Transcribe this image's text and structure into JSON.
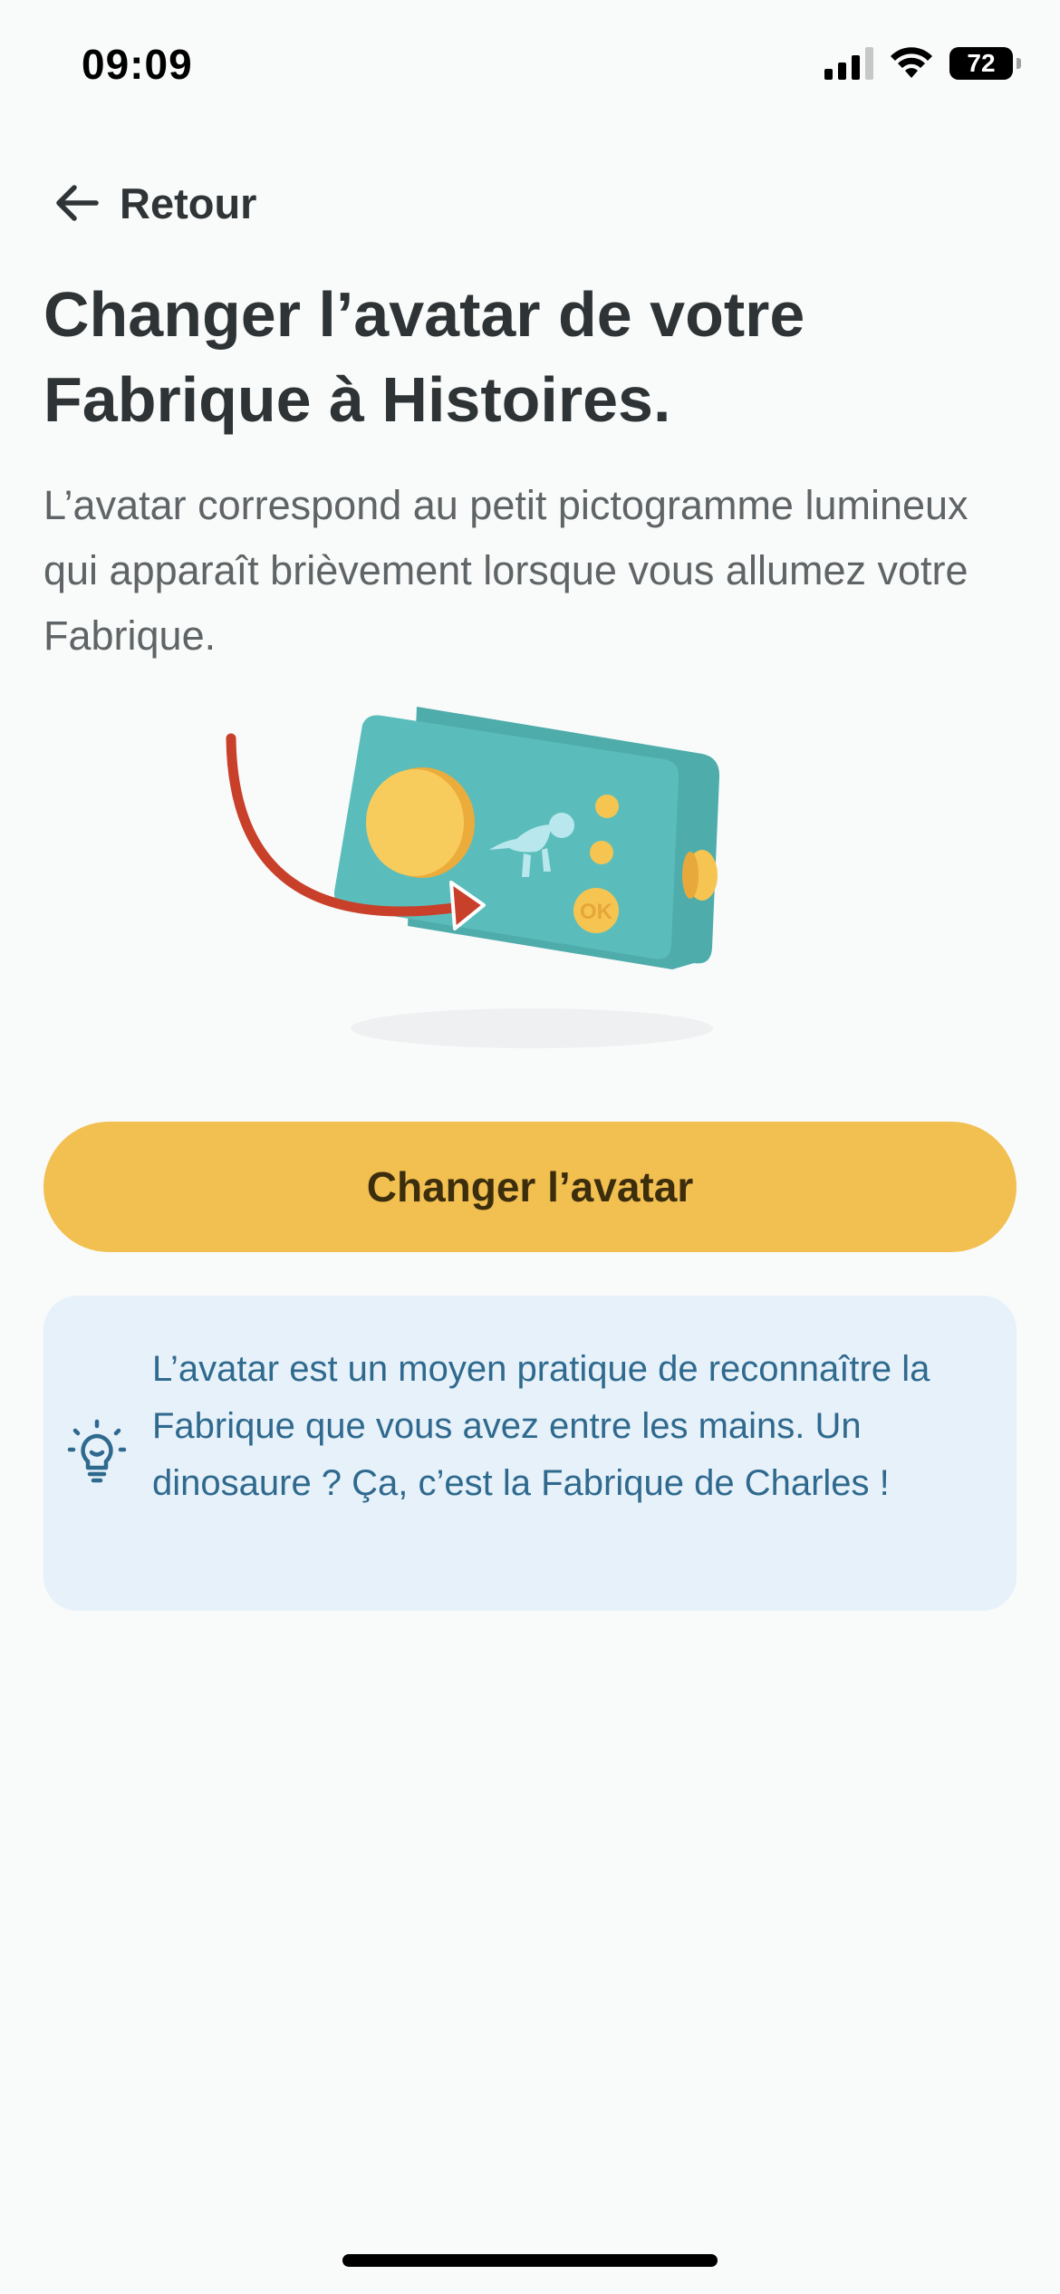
{
  "status_bar": {
    "time": "09:09",
    "battery": "72"
  },
  "nav": {
    "back_label": "Retour"
  },
  "page": {
    "title": "Changer l’avatar de votre Fabrique à Histoires.",
    "description": "L’avatar correspond au petit pictogramme lumineux qui apparaît brièvement lorsque vous allumez votre Fabrique."
  },
  "illustration": {
    "button_label": "OK"
  },
  "actions": {
    "change_avatar_label": "Changer l’avatar"
  },
  "info_card": {
    "icon": "lightbulb-icon",
    "text": "L’avatar est un moyen pratique de reconnaître la Fabrique que vous avez entre les mains. Un dinosaure ? Ça, c’est la Fabrique de Charles !"
  },
  "colors": {
    "accent": "#f2bf51",
    "info_background": "#e7f1fa",
    "info_text": "#2f6a8e",
    "device": "#5bbdbb",
    "arrow": "#c9402a"
  }
}
